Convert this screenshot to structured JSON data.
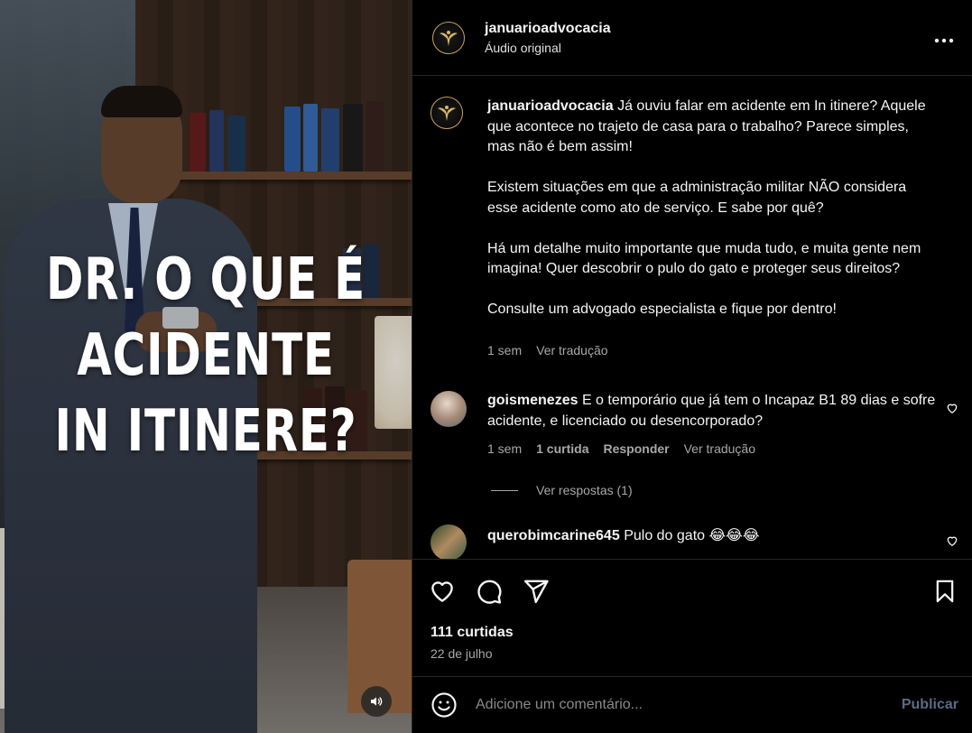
{
  "video": {
    "overlay_lines": [
      "DR. O QUE É",
      "ACIDENTE",
      "IN ITINERE?"
    ],
    "mute_icon": "speaker-icon"
  },
  "header": {
    "username": "januarioadvocacia",
    "audio": "Áudio original",
    "more_icon": "more-dots-icon"
  },
  "caption": {
    "username": "januarioadvocacia",
    "paragraphs": [
      "Já ouviu falar em acidente em In itinere? Aquele que acontece no trajeto de casa para o trabalho? Parece simples, mas não é bem assim!",
      "Existem situações em que a administração militar NÃO considera esse acidente como ato de serviço. E sabe por quê?",
      "Há um detalhe muito importante que muda tudo, e muita gente nem imagina! Quer descobrir o pulo do gato e proteger seus direitos?",
      "Consulte um advogado especialista e fique por dentro!"
    ],
    "time": "1 sem",
    "translate": "Ver tradução"
  },
  "comments": [
    {
      "username": "goismenezes",
      "text": "E o temporário que já tem o Incapaz B1 89 dias e sofre acidente, e licenciado ou desencorporado?",
      "time": "1 sem",
      "likes": "1 curtida",
      "reply": "Responder",
      "translate": "Ver tradução",
      "view_replies": "Ver respostas (1)"
    },
    {
      "username": "querobimcarine645",
      "text": "Pulo do gato 😂😂😂"
    }
  ],
  "actions": {
    "likes": "111 curtidas",
    "date": "22 de julho"
  },
  "composer": {
    "placeholder": "Adicione um comentário...",
    "publish": "Publicar"
  },
  "colors": {
    "background": "#000000",
    "muted_text": "#a8a8a8",
    "publish_disabled": "#5c6a83",
    "avatar_ring": "#c7a25a"
  }
}
